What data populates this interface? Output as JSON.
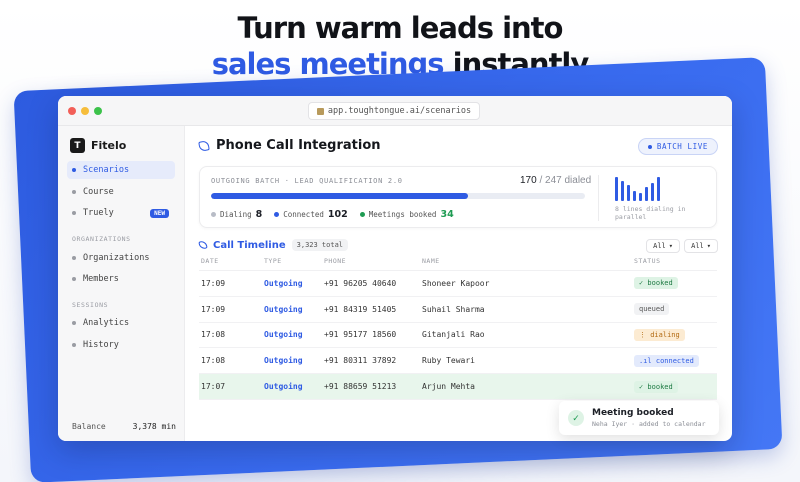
{
  "headline": {
    "line1": "Turn warm leads into",
    "line2_accent": "sales meetings",
    "line2_rest": " instantly"
  },
  "browser": {
    "url": "app.toughtongue.ai/scenarios"
  },
  "sidebar": {
    "brand_letter": "T",
    "brand_name": "Fitelo",
    "items": [
      {
        "label": "Scenarios"
      },
      {
        "label": "Course"
      },
      {
        "label": "Truely",
        "badge": "NEW"
      }
    ],
    "section_orgs": "ORGANIZATIONS",
    "org_items": [
      {
        "label": "Organizations"
      },
      {
        "label": "Members"
      }
    ],
    "section_sessions": "SESSIONS",
    "session_items": [
      {
        "label": "Analytics"
      },
      {
        "label": "History"
      }
    ],
    "balance_label": "Balance",
    "balance_value": "3,378 min"
  },
  "main": {
    "title": "Phone Call Integration",
    "live_label": "BATCH LIVE",
    "batch": {
      "title": "OUTGOING BATCH · LEAD QUALIFICATION 2.0",
      "dialed": "170",
      "total": " / 247 dialed",
      "progress_percent": 68.8,
      "stats": [
        {
          "label": "Dialing",
          "value": "8",
          "color": "#b8bcc6"
        },
        {
          "label": "Connected",
          "value": "102",
          "color": "#2f5be3"
        },
        {
          "label": "Meetings booked",
          "value": "34",
          "color": "#1e9b52"
        }
      ],
      "mini_caption": "8 lines dialing in parallel"
    },
    "timeline": {
      "title": "Call Timeline",
      "total": "3,323 total",
      "filter1": "All",
      "filter2": "All",
      "columns": [
        "DATE",
        "TYPE",
        "PHONE",
        "NAME",
        "STATUS"
      ],
      "rows": [
        {
          "date": "17:09",
          "type": "Outgoing",
          "phone": "+91 96205 40640",
          "name": "Shoneer Kapoor",
          "status": "✓ booked",
          "status_kind": "booked"
        },
        {
          "date": "17:09",
          "type": "Outgoing",
          "phone": "+91 84319 51405",
          "name": "Suhail Sharma",
          "status": "queued",
          "status_kind": "queued"
        },
        {
          "date": "17:08",
          "type": "Outgoing",
          "phone": "+91 95177 18560",
          "name": "Gitanjali Rao",
          "status": "⋮ dialing",
          "status_kind": "dialing"
        },
        {
          "date": "17:08",
          "type": "Outgoing",
          "phone": "+91 80311 37892",
          "name": "Ruby Tewari",
          "status": ".ıl connected",
          "status_kind": "connected"
        },
        {
          "date": "17:07",
          "type": "Outgoing",
          "phone": "+91 88659 51213",
          "name": "Arjun Mehta",
          "status": "✓ booked",
          "status_kind": "booked"
        }
      ]
    }
  },
  "toast": {
    "title": "Meeting booked",
    "subtitle": "Neha Iyer · added to calendar"
  }
}
